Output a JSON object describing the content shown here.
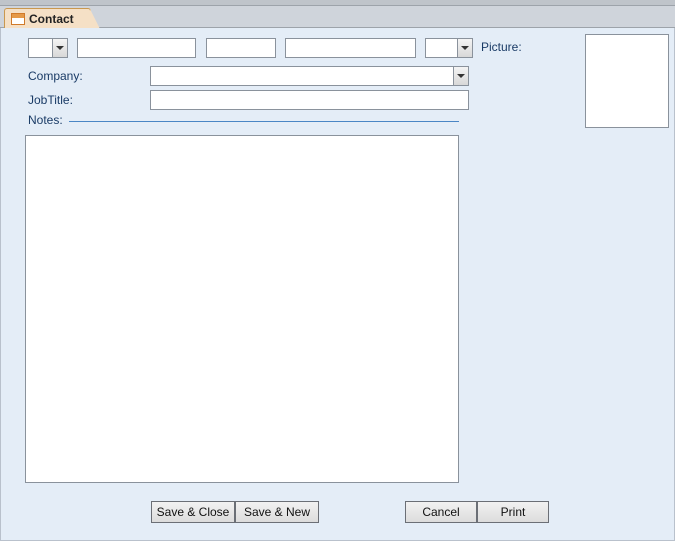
{
  "tab": {
    "title": "Contact"
  },
  "labels": {
    "company": "Company:",
    "jobtitle": "JobTitle:",
    "notes": "Notes:",
    "picture": "Picture:"
  },
  "fields": {
    "prefix": "",
    "first_name": "",
    "middle": "",
    "last_name": "",
    "suffix": "",
    "company": "",
    "jobtitle": "",
    "notes": ""
  },
  "buttons": {
    "save_close": "Save & Close",
    "save_new": "Save & New",
    "cancel": "Cancel",
    "print": "Print"
  }
}
